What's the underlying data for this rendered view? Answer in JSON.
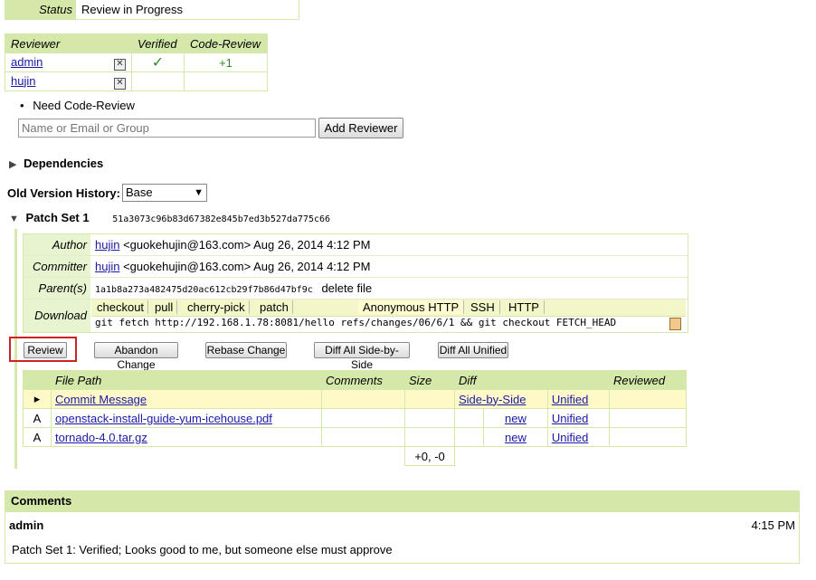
{
  "status": {
    "label": "Status",
    "value": "Review in Progress"
  },
  "reviewers": {
    "headers": [
      "Reviewer",
      "Verified",
      "Code-Review"
    ],
    "rows": [
      {
        "name": "admin",
        "verified": "✓",
        "code_review": "+1"
      },
      {
        "name": "hujin",
        "verified": "",
        "code_review": ""
      }
    ],
    "remove_glyph": "✕",
    "need": "Need Code-Review",
    "bullet": "•",
    "input_placeholder": "Name or Email or Group",
    "add_button": "Add Reviewer"
  },
  "dependencies": {
    "label": "Dependencies",
    "arrow": "▶"
  },
  "old_version": {
    "label": "Old Version History:",
    "selected": "Base"
  },
  "patch_set": {
    "arrow": "▼",
    "title": "Patch Set 1",
    "hash": "51a3073c96b83d67382e845b7ed3b527da775c66",
    "author_label": "Author",
    "author_name": "hujin",
    "author_rest": "<guokehujin@163.com> Aug 26, 2014 4:12 PM",
    "committer_label": "Committer",
    "committer_name": "hujin",
    "committer_rest": "<guokehujin@163.com> Aug 26, 2014 4:12 PM",
    "parent_label": "Parent(s)",
    "parent_hash": "1a1b8a273a482475d20ac612cb29f7b86d47bf9c",
    "parent_msg": "delete file",
    "download_label": "Download",
    "download_tabs": [
      "checkout",
      "pull",
      "cherry-pick",
      "patch"
    ],
    "protocol_tabs": [
      "Anonymous HTTP",
      "SSH",
      "HTTP"
    ],
    "command": "git fetch http://192.168.1.78:8081/hello refs/changes/06/6/1 && git checkout FETCH_HEAD",
    "buttons": [
      "Review",
      "Abandon Change",
      "Rebase Change",
      "Diff All Side-by-Side",
      "Diff All Unified"
    ]
  },
  "files": {
    "headers": [
      "File Path",
      "Comments",
      "Size",
      "Diff",
      "Reviewed"
    ],
    "rows": [
      {
        "mark": "▸",
        "path": "Commit Message",
        "diff1": "Side-by-Side",
        "diff2": "Unified"
      },
      {
        "mark": "A",
        "path": "openstack-install-guide-yum-icehouse.pdf",
        "diff1": "new",
        "diff2": "Unified"
      },
      {
        "mark": "A",
        "path": "tornado-4.0.tar.gz",
        "diff1": "new",
        "diff2": "Unified"
      }
    ],
    "total": "+0, -0"
  },
  "comments": {
    "title": "Comments",
    "author": "admin",
    "time": "4:15 PM",
    "text": "Patch Set 1: Verified; Looks good to me, but someone else must approve"
  },
  "colors": {
    "header_green": "#d4e9a9",
    "link": "#1a1aa6",
    "highlight_red": "#cc0000",
    "check_green": "#2e8b22"
  }
}
